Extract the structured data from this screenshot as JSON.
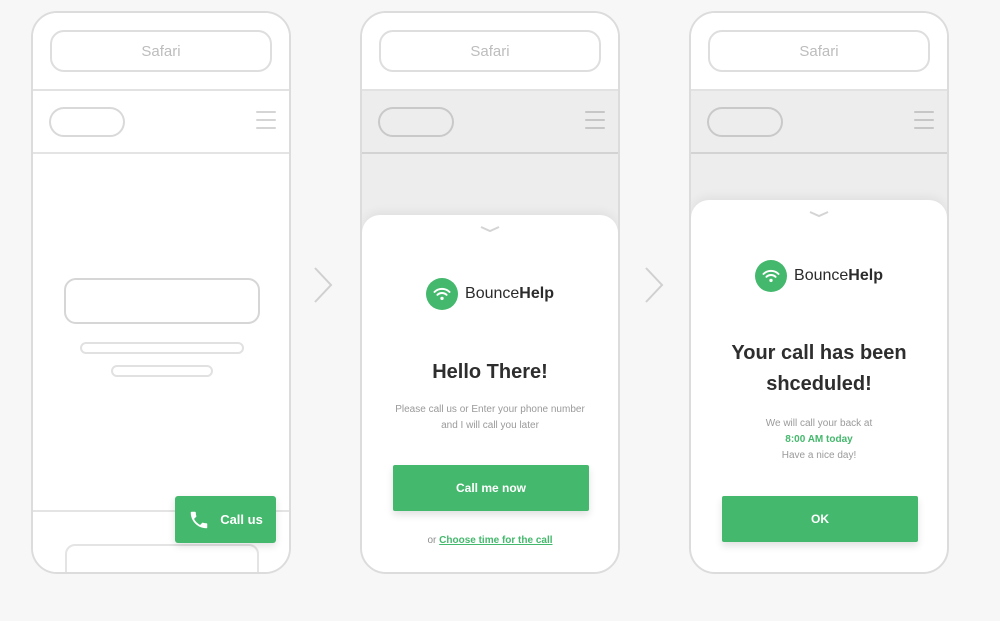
{
  "steps": [
    {
      "browser_title": "Safari",
      "call_us_label": "Call us"
    },
    {
      "browser_title": "Safari",
      "brand": {
        "prefix": "Bounce",
        "suffix": "Help"
      },
      "heading": "Hello There!",
      "subtext": "Please call us or Enter your phone number and I will call you later",
      "primary_button": "Call me now",
      "alt_prefix": "or",
      "alt_link": "Choose time for the call"
    },
    {
      "browser_title": "Safari",
      "brand": {
        "prefix": "Bounce",
        "suffix": "Help"
      },
      "heading_line1": "Your call has been",
      "heading_line2": "shceduled!",
      "subtext_line1": "We will call your back at",
      "time": "8:00 AM today",
      "subtext_line3": "Have a nice day!",
      "primary_button": "OK"
    }
  ],
  "colors": {
    "accent": "#44b86c",
    "outline": "#dcdcdc",
    "heading": "#2e2e2e",
    "muted": "#9a9a9a"
  },
  "icons": [
    "phone-icon",
    "wifi-icon",
    "chevron-right-icon",
    "hamburger-menu-icon",
    "drag-handle-icon"
  ]
}
